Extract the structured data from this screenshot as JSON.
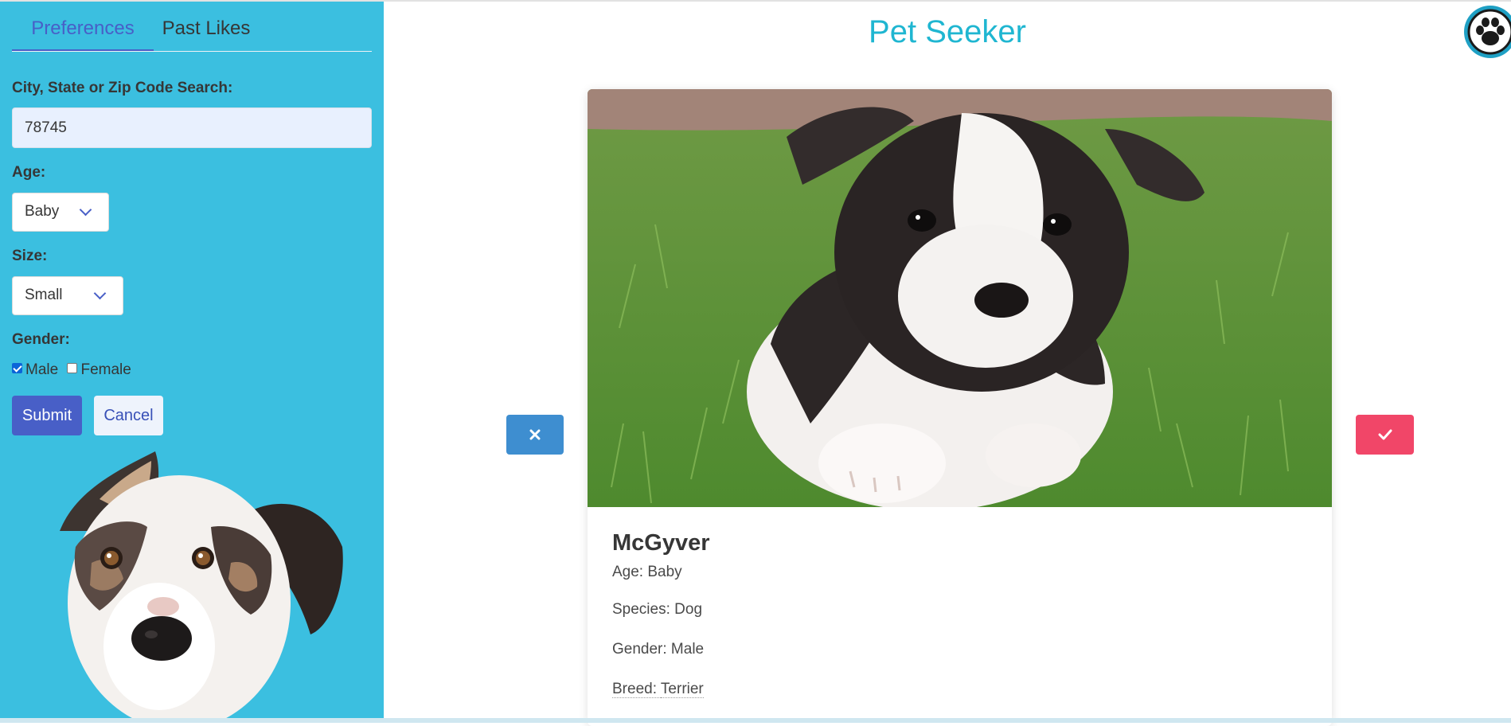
{
  "app": {
    "title": "Pet Seeker"
  },
  "sidebar": {
    "tabs": [
      {
        "label": "Preferences",
        "active": true
      },
      {
        "label": "Past Likes",
        "active": false
      }
    ],
    "search": {
      "label": "City, State or Zip Code Search:",
      "value": "78745"
    },
    "age": {
      "label": "Age:",
      "selected": "Baby"
    },
    "size": {
      "label": "Size:",
      "selected": "Small"
    },
    "gender": {
      "label": "Gender:",
      "options": [
        {
          "label": "Male",
          "checked": true
        },
        {
          "label": "Female",
          "checked": false
        }
      ]
    },
    "submit_label": "Submit",
    "cancel_label": "Cancel"
  },
  "pet": {
    "name": "McGyver",
    "age": "Age: Baby",
    "species": "Species: Dog",
    "gender": "Gender: Male",
    "breed_prefix": "Breed: ",
    "breed": "Terrier"
  },
  "actions": {
    "reject_icon": "x-icon",
    "like_icon": "check-icon"
  },
  "colors": {
    "sidebar_bg": "#3bbfe0",
    "accent": "#485fc7",
    "title": "#1fb6d1",
    "reject": "#3e8ed0",
    "like": "#f14668"
  }
}
